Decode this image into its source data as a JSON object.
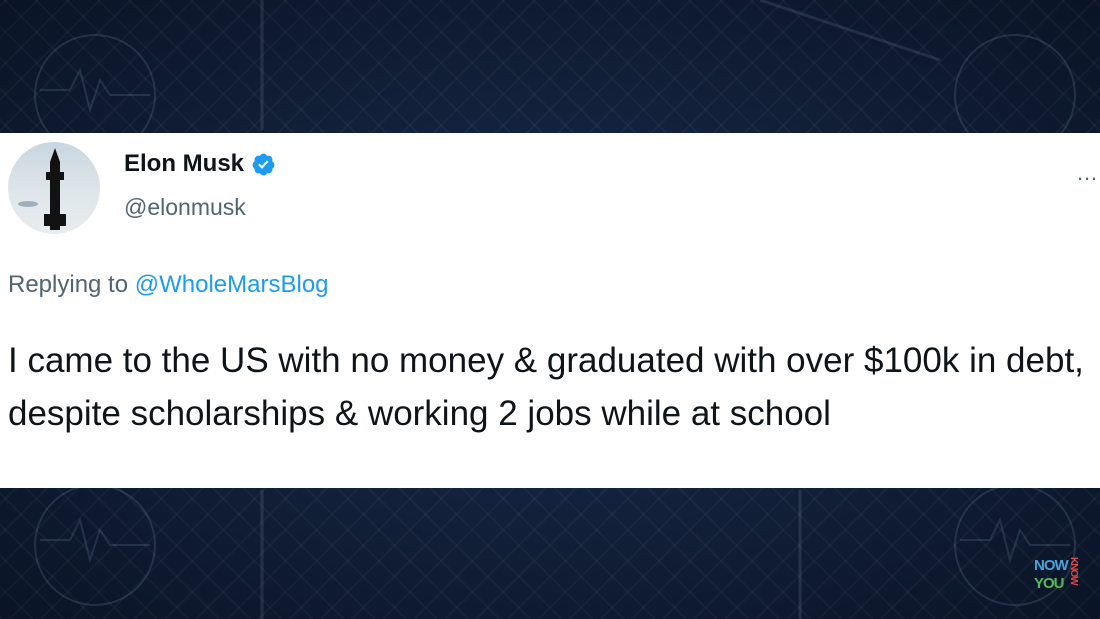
{
  "tweet": {
    "author_name": "Elon Musk",
    "author_handle": "@elonmusk",
    "verified": true,
    "replying_to_prefix": "Replying to",
    "replying_to_handle": "@WholeMarsBlog",
    "text": "I came to the US with no money & graduated with over $100k in debt, despite scholarships & working 2 jobs while at school",
    "more_label": "…"
  },
  "icons": {
    "verified": "verified-badge-icon",
    "more": "more-options-icon",
    "avatar": "starship-avatar"
  },
  "watermark": {
    "line1": "NOW",
    "line2": "YOU",
    "line3": "KNOW"
  },
  "colors": {
    "link": "#1d9bf0",
    "secondary_text": "#536471",
    "primary_text": "#0f1419",
    "background": "#0f1c33"
  }
}
